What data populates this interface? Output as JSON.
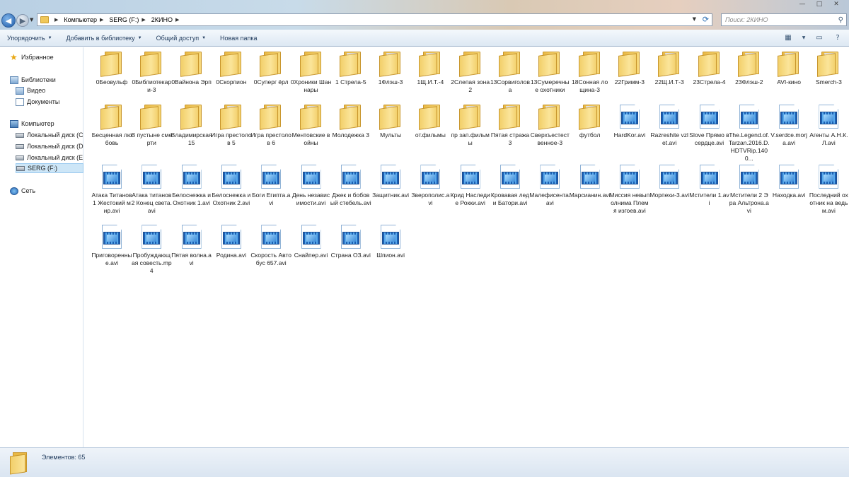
{
  "window": {
    "breadcrumb": [
      "Компьютер",
      "SERG  (F:)",
      "2КИНО"
    ],
    "search_placeholder": "Поиск: 2КИНО",
    "controls": {
      "minimize": "—",
      "maximize": "□",
      "close": "✕"
    }
  },
  "toolbar": {
    "organize": "Упорядочить",
    "add_to_library": "Добавить в библиотеку",
    "share": "Общий доступ",
    "new_folder": "Новая папка"
  },
  "sidebar": {
    "favorites": "Избранное",
    "libraries": "Библиотеки",
    "video": "Видео",
    "documents": "Документы",
    "computer": "Компьютер",
    "disk_c": "Локальный диск (C",
    "disk_d": "Локальный диск (D",
    "disk_e": "Локальный диск (E",
    "serg": "SERG  (F:)",
    "network": "Сеть"
  },
  "files": [
    {
      "name": "0Беовульф",
      "type": "folder"
    },
    {
      "name": "0Библиотекари-3",
      "type": "folder"
    },
    {
      "name": "0Вайнона Эрп",
      "type": "folder"
    },
    {
      "name": "0Скорпион",
      "type": "folder"
    },
    {
      "name": "0Суперг ёрл",
      "type": "folder"
    },
    {
      "name": "0Хроники Шаннары",
      "type": "folder"
    },
    {
      "name": "1 Стрела-5",
      "type": "video-folder"
    },
    {
      "name": "1Флэш-3",
      "type": "video-folder"
    },
    {
      "name": "1Щ.И.Т.-4",
      "type": "video-folder"
    },
    {
      "name": "2Слепая зона 2",
      "type": "folder"
    },
    {
      "name": "13Сорвиголова",
      "type": "folder"
    },
    {
      "name": "13Сумеречные охотники",
      "type": "folder"
    },
    {
      "name": "18Сонная лощина-3",
      "type": "folder"
    },
    {
      "name": "22Гримм-3",
      "type": "folder"
    },
    {
      "name": "22Щ.И.Т-3",
      "type": "video-folder"
    },
    {
      "name": "23Стрела-4",
      "type": "folder"
    },
    {
      "name": "23Флэш-2",
      "type": "video-folder"
    },
    {
      "name": "AVI-кино",
      "type": "video-folder"
    },
    {
      "name": "Smerch-3",
      "type": "video-folder"
    },
    {
      "name": "Бесценная любовь",
      "type": "video-folder"
    },
    {
      "name": "В пустыне смерти",
      "type": "folder"
    },
    {
      "name": "Владимирская 15",
      "type": "folder"
    },
    {
      "name": "Игра престолов 5",
      "type": "video-folder"
    },
    {
      "name": "Игра престолов 6",
      "type": "video-folder"
    },
    {
      "name": "Ментовские войны",
      "type": "video-folder"
    },
    {
      "name": "Молодежка 3",
      "type": "video-folder"
    },
    {
      "name": "Мульты",
      "type": "video-folder"
    },
    {
      "name": "от.фильмы",
      "type": "folder"
    },
    {
      "name": "пр зап.фильмы",
      "type": "video-folder"
    },
    {
      "name": "Пятая стража 3",
      "type": "video-folder"
    },
    {
      "name": "Сверхъестественное-3",
      "type": "video-folder"
    },
    {
      "name": "футбол",
      "type": "video-folder"
    },
    {
      "name": "HardKor.avi",
      "type": "avi"
    },
    {
      "name": "Razreshite vzlet.avi",
      "type": "avi"
    },
    {
      "name": "Slove Прямо в сердце.avi",
      "type": "avi"
    },
    {
      "name": "The.Legend.of.Tarzan.2016.D.HDTVRip.1400...",
      "type": "avi"
    },
    {
      "name": "V.serdce.morja.avi",
      "type": "avi"
    },
    {
      "name": "Агенты А.Н.К.Л.avi",
      "type": "avi"
    },
    {
      "name": "Атака Титанов 1 Жестокий мир.avi",
      "type": "avi"
    },
    {
      "name": "Атака титанов 2 Конец света.avi",
      "type": "avi"
    },
    {
      "name": "Белоснежка и Охотник 1.avi",
      "type": "avi"
    },
    {
      "name": "Белоснежка и Охотник 2.avi",
      "type": "avi"
    },
    {
      "name": "Боги Египта.avi",
      "type": "avi"
    },
    {
      "name": "День независимости.avi",
      "type": "avi"
    },
    {
      "name": "Джек и бобовый стебель.avi",
      "type": "avi"
    },
    {
      "name": "Защитник.avi",
      "type": "avi"
    },
    {
      "name": "Зверополис.avi",
      "type": "avi"
    },
    {
      "name": "Крид Наследие Рокки.avi",
      "type": "avi"
    },
    {
      "name": "Кровавая леди Батори.avi",
      "type": "avi"
    },
    {
      "name": "Малефисента.avi",
      "type": "avi"
    },
    {
      "name": "Марсианин.avi",
      "type": "avi"
    },
    {
      "name": "Миссия невыполнима Племя изгоев.avi",
      "type": "avi"
    },
    {
      "name": "Морпехи-3.avi",
      "type": "avi"
    },
    {
      "name": "Мстители 1.avi",
      "type": "avi"
    },
    {
      "name": "Мстители 2 Эра Альтрона.avi",
      "type": "avi"
    },
    {
      "name": "Находка.avi",
      "type": "avi"
    },
    {
      "name": "Последний охотник на ведьм.avi",
      "type": "avi"
    },
    {
      "name": "Приговоренные.avi",
      "type": "avi"
    },
    {
      "name": "Пробуждающая совесть.mp4",
      "type": "avi"
    },
    {
      "name": "Пятая волна.avi",
      "type": "avi"
    },
    {
      "name": "Родина.avi",
      "type": "avi"
    },
    {
      "name": "Скорость Автобус 657.avi",
      "type": "avi"
    },
    {
      "name": "Снайпер.avi",
      "type": "avi"
    },
    {
      "name": "Страна ОЗ.avi",
      "type": "avi"
    },
    {
      "name": "Шпион.avi",
      "type": "avi"
    }
  ],
  "status": {
    "items_count": "Элементов: 65"
  }
}
